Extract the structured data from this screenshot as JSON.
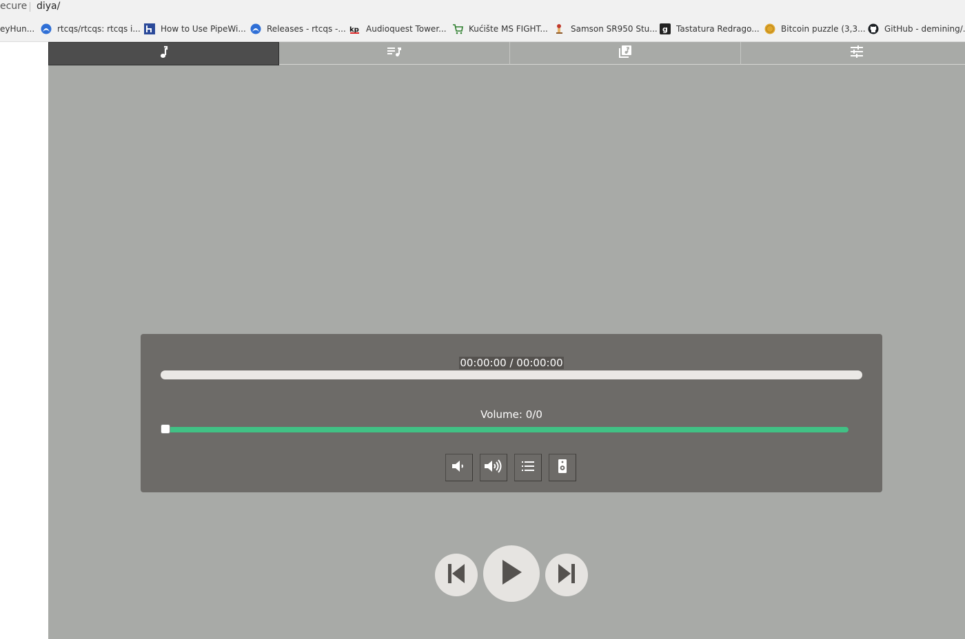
{
  "browser": {
    "url_secure_fragment": "ecure",
    "url_path": "diya/",
    "bookmarks": [
      {
        "label": "eyHun...",
        "icon": "none"
      },
      {
        "label": "rtcqs/rtcqs: rtcqs i...",
        "icon": "rtcqs-logo-icon"
      },
      {
        "label": "How to Use PipeWi...",
        "icon": "h-logo-icon"
      },
      {
        "label": "Releases - rtcqs -...",
        "icon": "rtcqs-logo-icon"
      },
      {
        "label": "Audioquest Tower...",
        "icon": "kp-logo-icon"
      },
      {
        "label": "Kućište MS FIGHT...",
        "icon": "shopping-cart-icon"
      },
      {
        "label": "Samson SR950 Stu...",
        "icon": "mascot-icon"
      },
      {
        "label": "Tastatura Redrago...",
        "icon": "g-logo-icon"
      },
      {
        "label": "Bitcoin puzzle (3,3...",
        "icon": "coin-icon"
      },
      {
        "label": "GitHub - demining/...",
        "icon": "github-icon"
      }
    ]
  },
  "tabs": [
    {
      "name": "now-playing",
      "icon": "music-note-icon",
      "active": true
    },
    {
      "name": "queue",
      "icon": "playlist-icon",
      "active": false
    },
    {
      "name": "library",
      "icon": "library-music-icon",
      "active": false
    },
    {
      "name": "settings",
      "icon": "sliders-icon",
      "active": false
    }
  ],
  "player": {
    "time_display": "00:00:00 / 00:00:00",
    "progress_fraction": 0,
    "volume_label": "Volume: 0/0",
    "volume_fraction": 0,
    "controls": [
      {
        "name": "volume-down",
        "icon": "volume-down-icon"
      },
      {
        "name": "volume-up",
        "icon": "volume-up-icon"
      },
      {
        "name": "list",
        "icon": "list-icon"
      },
      {
        "name": "output",
        "icon": "speaker-icon"
      }
    ]
  },
  "colors": {
    "app_background": "#a8aaa7",
    "panel_background": "#6d6b68",
    "active_tab": "#4d4d4d",
    "volume_accent": "#41c185",
    "transport_button": "#e6e4e1"
  }
}
